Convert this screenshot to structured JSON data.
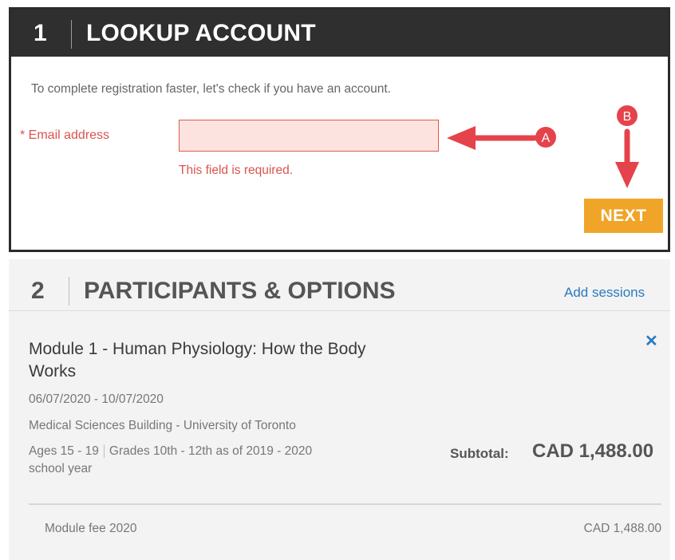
{
  "section1": {
    "number": "1",
    "title": "LOOKUP ACCOUNT",
    "intro": "To complete registration faster, let's check if you have an account.",
    "email_label": "* Email address",
    "email_value": "",
    "error": "This field is required.",
    "next_label": "NEXT"
  },
  "annotations": {
    "a_label": "A",
    "b_label": "B",
    "color": "#e5434c"
  },
  "section2": {
    "number": "2",
    "title": "PARTICIPANTS & OPTIONS",
    "add_sessions": "Add sessions",
    "remove_icon": "close-icon",
    "module_title": "Module 1 - Human Physiology: How the Body Works",
    "dates": "06/07/2020 - 10/07/2020",
    "location": "Medical Sciences Building - University of Toronto",
    "ages": "Ages 15 - 19",
    "grades": "Grades 10th - 12th as of 2019 - 2020",
    "grades_cont": "school year",
    "subtotal_label": "Subtotal:",
    "subtotal_value": "CAD 1,488.00",
    "fee_label": "Module fee 2020",
    "fee_value": "CAD 1,488.00"
  },
  "colors": {
    "accent_orange": "#f0a428",
    "link_blue": "#2a7abf",
    "error_red": "#d9534f",
    "header_dark": "#2f2f2f"
  }
}
